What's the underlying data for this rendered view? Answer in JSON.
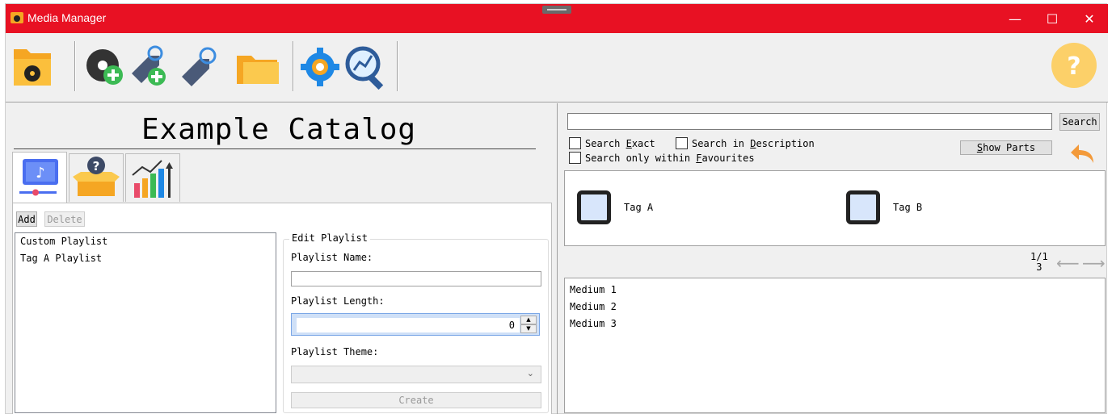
{
  "window": {
    "title": "Media Manager",
    "controls": {
      "minimize": "—",
      "maximize": "☐",
      "close": "✕"
    }
  },
  "toolbar": {
    "icons": [
      "open-catalog-icon",
      "add-medium-icon",
      "add-tag-icon",
      "edit-tags-icon",
      "folder-icon",
      "settings-icon",
      "statistics-search-icon",
      "help-icon"
    ],
    "help_label": "?"
  },
  "catalog": {
    "title": "Example Catalog"
  },
  "tabs": [
    {
      "name": "playlists",
      "icon": "music-playlist-icon",
      "active": true
    },
    {
      "name": "unknown",
      "icon": "question-box-icon",
      "active": false
    },
    {
      "name": "statistics",
      "icon": "bar-chart-icon",
      "active": false
    }
  ],
  "playlists": {
    "add_label": "Add",
    "delete_label": "Delete",
    "items": [
      "Custom Playlist",
      "Tag A Playlist"
    ],
    "edit": {
      "legend": "Edit Playlist",
      "name_label": "Playlist Name:",
      "name_value": "",
      "length_label": "Playlist Length:",
      "length_value": "0",
      "theme_label": "Playlist Theme:",
      "theme_value": "",
      "create_label": "Create"
    }
  },
  "search": {
    "query": "",
    "button_label": "Search",
    "exact_label_pre": "Search ",
    "exact_label_key": "E",
    "exact_label_post": "xact",
    "desc_label_pre": "Search in ",
    "desc_label_key": "D",
    "desc_label_post": "escription",
    "fav_label_pre": "Search only within ",
    "fav_label_key": "F",
    "fav_label_post": "avourites",
    "show_parts_key": "S",
    "show_parts_rest": "how Parts"
  },
  "tags": [
    {
      "label": "Tag A",
      "checked": false
    },
    {
      "label": "Tag B",
      "checked": false
    }
  ],
  "paging": {
    "page": "1/1",
    "count": "3"
  },
  "media": [
    "Medium 1",
    "Medium 2",
    "Medium 3"
  ]
}
